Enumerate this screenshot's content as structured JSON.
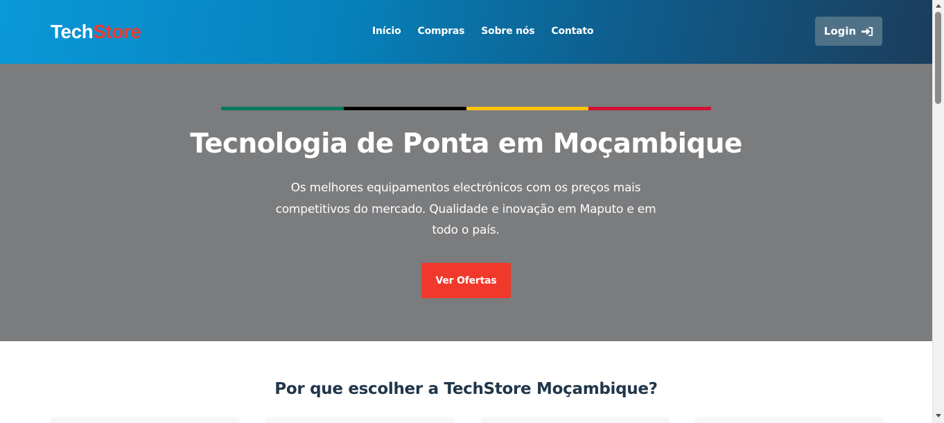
{
  "header": {
    "logo_part1": "Tech",
    "logo_part2": "Store",
    "nav": [
      "Início",
      "Compras",
      "Sobre nós",
      "Contato"
    ],
    "login_label": "Login",
    "login_icon": "sign-in-icon"
  },
  "hero": {
    "flag_colors": [
      "#007a5e",
      "#000000",
      "#fcc40f",
      "#d21034"
    ],
    "title": "Tecnologia de Ponta em Moçambique",
    "description": "Os melhores equipamentos electrónicos com os preços mais competitivos do mercado. Qualidade e inovação em Maputo e em todo o país.",
    "cta_label": "Ver Ofertas"
  },
  "features": {
    "title": "Por que escolher a TechStore Moçambique?"
  },
  "colors": {
    "brand_blue": "#0a98d8",
    "brand_red": "#f0392b",
    "hero_bg": "#7b7c7e",
    "heading": "#20364b"
  }
}
